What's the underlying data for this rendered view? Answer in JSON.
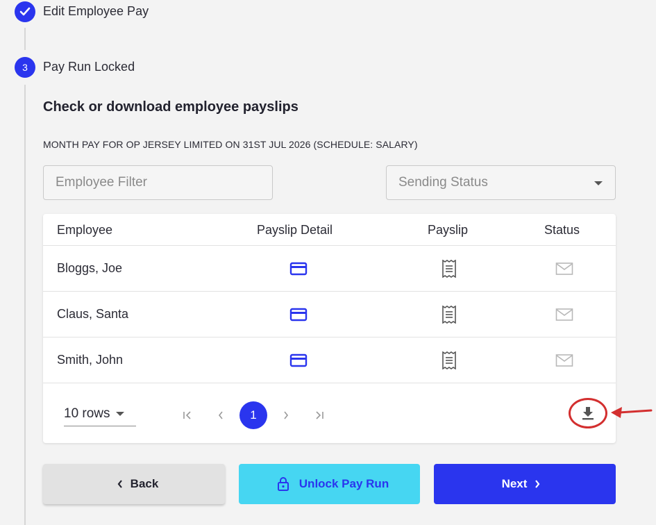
{
  "steps": [
    {
      "state": "done",
      "label": "Edit Employee Pay"
    },
    {
      "state": "active",
      "number": "3",
      "label": "Pay Run Locked"
    }
  ],
  "section": {
    "title": "Check or download employee payslips",
    "subtitle": "MONTH PAY FOR OP JERSEY LIMITED ON 31ST JUL 2026 (SCHEDULE: SALARY)"
  },
  "filters": {
    "employee_placeholder": "Employee Filter",
    "status_placeholder": "Sending Status"
  },
  "table": {
    "headers": [
      "Employee",
      "Payslip Detail",
      "Payslip",
      "Status"
    ],
    "rows": [
      {
        "employee": "Bloggs, Joe",
        "detail_icon": "card-icon",
        "payslip_icon": "receipt-icon",
        "status_icon": "mail-icon"
      },
      {
        "employee": "Claus, Santa",
        "detail_icon": "card-icon",
        "payslip_icon": "receipt-icon",
        "status_icon": "mail-icon"
      },
      {
        "employee": "Smith, John",
        "detail_icon": "card-icon",
        "payslip_icon": "receipt-icon",
        "status_icon": "mail-icon"
      }
    ]
  },
  "pagination": {
    "rows_label": "10 rows",
    "current_page": "1"
  },
  "actions": {
    "back": "Back",
    "unlock": "Unlock Pay Run",
    "next": "Next"
  },
  "colors": {
    "primary": "#2a35ee",
    "unlock_bg": "#46d6f2",
    "annotation": "#d32f2f"
  }
}
